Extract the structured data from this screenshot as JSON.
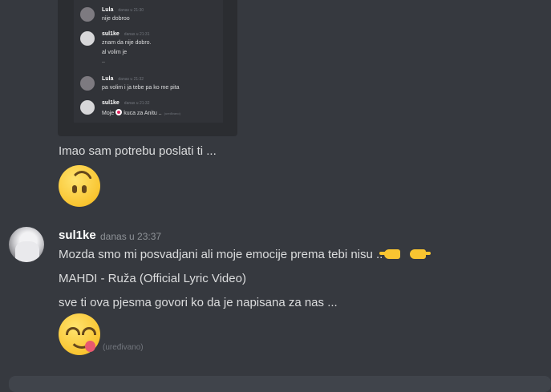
{
  "embed_screenshot": {
    "messages": [
      {
        "author": "Lula",
        "time": "danas u 21:30",
        "lines": [
          "nije dobroo"
        ],
        "avatar": "dark"
      },
      {
        "author": "sul1ke",
        "time": "danas u 21:31",
        "lines": [
          "znam da  nije dobro.",
          "al volim  je",
          ".."
        ],
        "avatar": "light"
      },
      {
        "author": "Lula",
        "time": "danas u 21:32",
        "lines": [
          "pa volim i ja tebe pa ko me pita"
        ],
        "avatar": "dark"
      },
      {
        "author": "sul1ke",
        "time": "danas u 21:32",
        "lines_prefix": "Moje",
        "lines_suffix": "kuca  za  Anitu ..",
        "edited": "(uređivano)",
        "avatar": "light"
      }
    ]
  },
  "prev_message": {
    "text": "Imao sam potrebu poslati ti ...",
    "emoji": "upside-down-face"
  },
  "message": {
    "author": "sul1ke",
    "timestamp": "danas u 23:37",
    "line1": "Mozda  smo mi   posvadjani ali moje emocije prema  tebi  nisu ..",
    "line2": "MAHDI - Ruža (Official Lyric Video)",
    "line3": "sve ti ova pjesma  govori ko  da je napisana za  nas ...",
    "emoji": "face-savoring-food",
    "edited": "(uređivano)"
  },
  "colors": {
    "background": "#36393f",
    "text": "#dcddde",
    "muted": "#72767d"
  }
}
